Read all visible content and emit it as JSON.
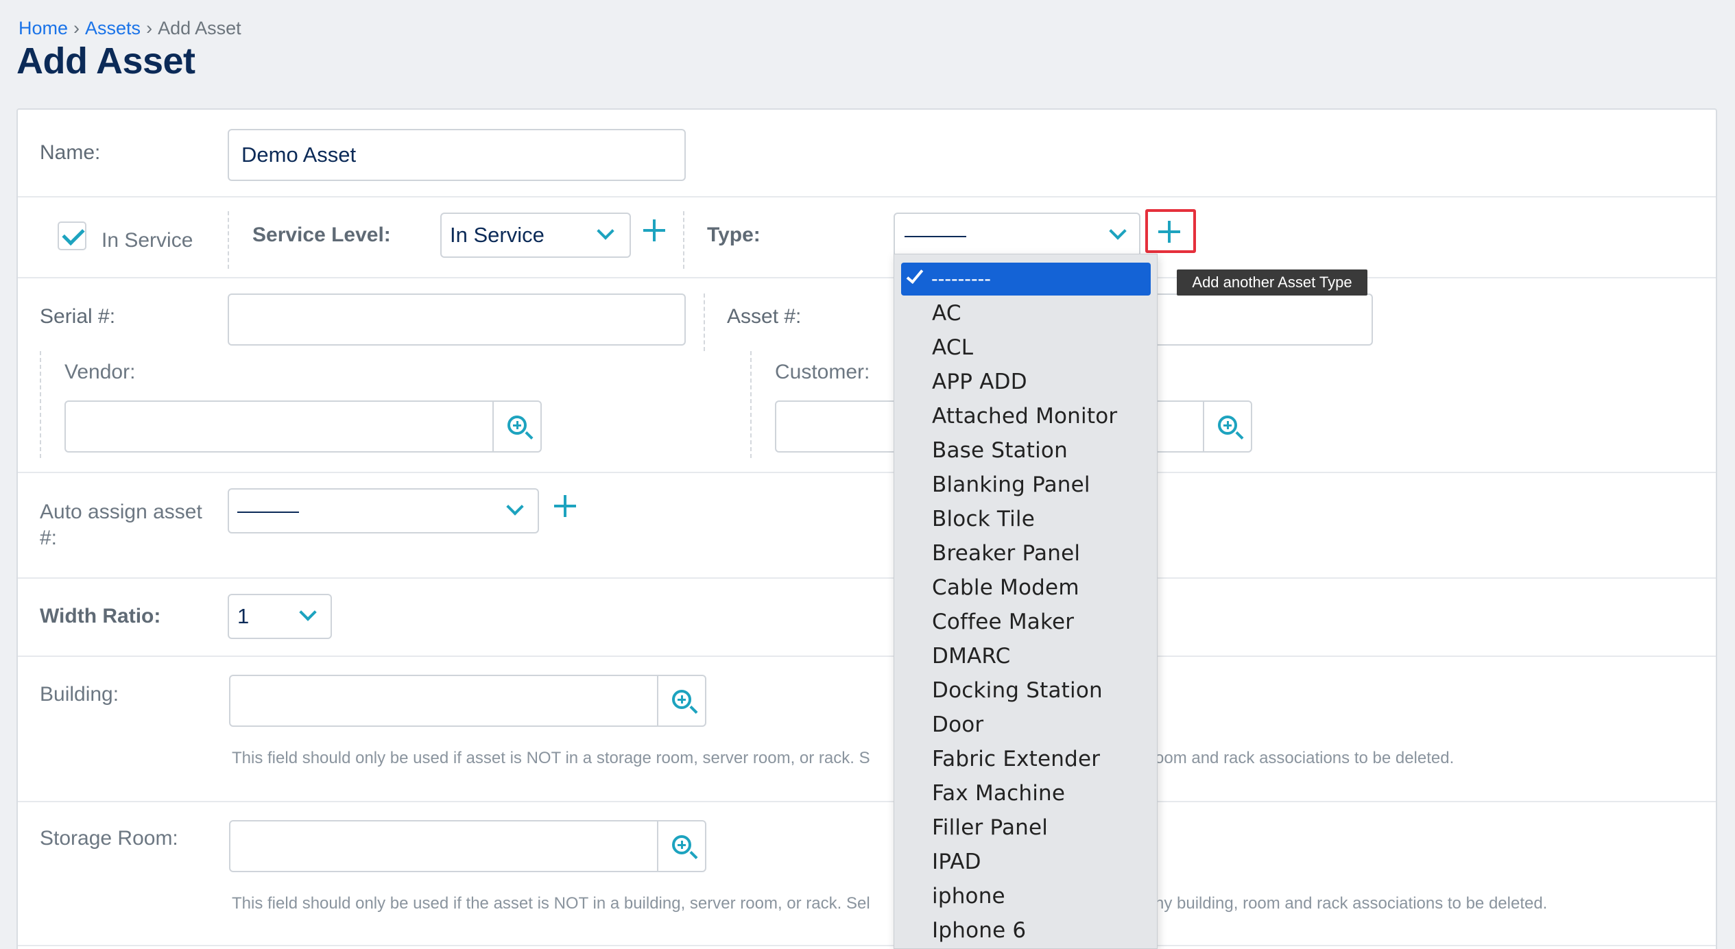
{
  "breadcrumb": {
    "home": "Home",
    "assets": "Assets",
    "sep": "›",
    "current": "Add Asset"
  },
  "page_title": "Add Asset",
  "form": {
    "name_label": "Name:",
    "name_value": "Demo Asset",
    "in_service_label": "In Service",
    "in_service_checked": true,
    "service_level_label": "Service Level:",
    "service_level_value": "In Service",
    "type_label": "Type:",
    "serial_label": "Serial #:",
    "asset_label": "Asset #:",
    "vendor_label": "Vendor:",
    "customer_label": "Customer:",
    "auto_assign_label": "Auto assign asset #:",
    "width_ratio_label": "Width Ratio:",
    "width_ratio_value": "1",
    "building_label": "Building:",
    "building_help_left": "This field should only be used if asset is NOT in a storage room, server room, or rack. S",
    "building_help_right": "oom and rack associations to be deleted.",
    "storage_room_label": "Storage Room:",
    "storage_help_left": "This field should only be used if the asset is NOT in a building, server room, or rack. Sel",
    "storage_help_right": "ny building, room and rack associations to be deleted."
  },
  "type_dropdown": {
    "selected": "---------",
    "options": [
      "AC",
      "ACL",
      "APP ADD",
      "Attached Monitor",
      "Base Station",
      "Blanking Panel",
      "Block Tile",
      "Breaker Panel",
      "Cable Modem",
      "Coffee Maker",
      "DMARC",
      "Docking Station",
      "Door",
      "Fabric Extender",
      "Fax Machine",
      "Filler Panel",
      "IPAD",
      "iphone",
      "Iphone 6"
    ]
  },
  "tooltip": "Add another Asset Type",
  "colors": {
    "accent": "#1da3bf",
    "title": "#0b2a57",
    "link": "#1a73e8",
    "highlight": "#1463d6",
    "callout": "#e5303c"
  }
}
